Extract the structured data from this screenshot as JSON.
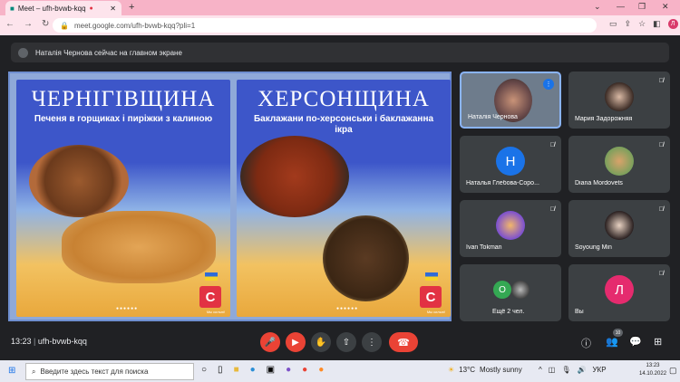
{
  "browser": {
    "tab_title": "Meet – ufh-bvwb-kqq",
    "url": "meet.google.com/ufh-bvwb-kqq?pli=1",
    "avatar_letter": "Л"
  },
  "meet": {
    "banner": "Наталія Чернова сейчас на главном экране",
    "slides": [
      {
        "title": "ЧЕРНІГІВЩИНА",
        "subtitle": "Печеня в горщиках і пиріжки з калиною",
        "logo": "C",
        "logo_text": "Мы сильні!"
      },
      {
        "title": "ХЕРСОНЩИНА",
        "subtitle": "Баклажани по-херсонськи і баклажанна ікра",
        "logo": "C",
        "logo_text": "Мы сильні!"
      }
    ],
    "participants": [
      {
        "name": "Наталія Чернова",
        "initial": ""
      },
      {
        "name": "Мария Задорожняя",
        "initial": ""
      },
      {
        "name": "Наталья Глебова-Соро...",
        "initial": "Н"
      },
      {
        "name": "Diana Mordovets",
        "initial": ""
      },
      {
        "name": "Ivan Tokman",
        "initial": ""
      },
      {
        "name": "Soyoung Min",
        "initial": ""
      },
      {
        "name": "Ещё 2 чел.",
        "initial": "O"
      },
      {
        "name": "Вы",
        "initial": "Л"
      }
    ],
    "time": "13:23",
    "meeting_code": "ufh-bvwb-kqq",
    "participant_count": "10",
    "colors": {
      "accent": "#1a73e8",
      "danger": "#ea4335",
      "background": "#202124"
    }
  },
  "taskbar": {
    "search_placeholder": "Введите здесь текст для поиска",
    "weather_temp": "13°C",
    "weather_text": "Mostly sunny",
    "lang": "УКР",
    "time": "13:23",
    "date": "14.10.2022"
  }
}
